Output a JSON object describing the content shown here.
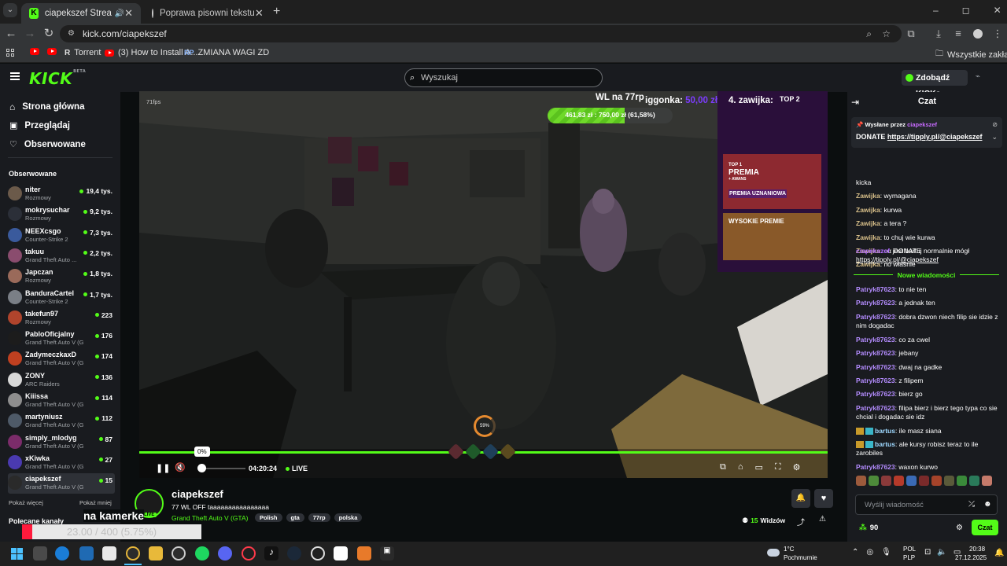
{
  "browser": {
    "tabs": [
      {
        "title": "ciapekszef Stream - Watch",
        "active": true
      },
      {
        "title": "Poprawa pisowni tekstu",
        "active": false
      }
    ],
    "new_tab": "+",
    "window_controls": [
      "–",
      "◻",
      "✕"
    ],
    "url": "kick.com/ciapekszef",
    "bookmarks": [
      "Torrent",
      "(3) How to Install A...",
      "ZMIANA WAGI ZD"
    ],
    "all_bookmarks": "Wszystkie zakładki"
  },
  "kick": {
    "logo": "KICK",
    "logo_badge": "BETA",
    "search_placeholder": "Wyszukaj",
    "get_kicks": "Zdobądź KICKs",
    "nav": [
      "Strona główna",
      "Przeglądaj",
      "Obserwowane"
    ],
    "following_header": "Obserwowane",
    "following": [
      {
        "name": "niter",
        "game": "Rozmowy",
        "viewers": "19,4 tys.",
        "color": "#6b5a4a"
      },
      {
        "name": "mokrysuchar",
        "game": "Rozmowy",
        "viewers": "9,2 tys.",
        "color": "#2b2f38"
      },
      {
        "name": "NEEXcsgo",
        "game": "Counter-Strike 2",
        "viewers": "7,3 tys.",
        "color": "#3a5a9c"
      },
      {
        "name": "takuu",
        "game": "Grand Theft Auto ...",
        "viewers": "2,2 tys.",
        "color": "#8a4c6e"
      },
      {
        "name": "Japczan",
        "game": "Rozmowy",
        "viewers": "1,8 tys.",
        "color": "#9a6a5a"
      },
      {
        "name": "BanduraCartel",
        "game": "Counter-Strike 2",
        "viewers": "1,7 tys.",
        "color": "#7a7f86"
      },
      {
        "name": "takefun97",
        "game": "Rozmowy",
        "viewers": "223",
        "color": "#b0442c"
      },
      {
        "name": "PabloOficjalny",
        "game": "Grand Theft Auto V (G...",
        "viewers": "176",
        "color": "#1c1c1c"
      },
      {
        "name": "ZadymeczkaxD",
        "game": "Grand Theft Auto V (G...",
        "viewers": "174",
        "color": "#c04020"
      },
      {
        "name": "ZONY",
        "game": "ARC Raiders",
        "viewers": "136",
        "color": "#d8d8d8"
      },
      {
        "name": "Kiiissa",
        "game": "Grand Theft Auto V (G...",
        "viewers": "114",
        "color": "#8e8e8e"
      },
      {
        "name": "martyniusz",
        "game": "Grand Theft Auto V (GT...",
        "viewers": "112",
        "color": "#4e5a68"
      },
      {
        "name": "simply_mlodyg",
        "game": "Grand Theft Auto V (GTA)",
        "viewers": "87",
        "color": "#7b2c6a"
      },
      {
        "name": "xKiwka",
        "game": "Grand Theft Auto V (GTA)",
        "viewers": "27",
        "color": "#4a3ab0"
      },
      {
        "name": "ciapekszef",
        "game": "Grand Theft Auto V (GTA)",
        "viewers": "15",
        "color": "#2a2a2a"
      }
    ],
    "show_more": "Pokaż więcej",
    "show_less": "Pokaż mniej",
    "recommended": "Polecane kanały",
    "overlay_kamerka": "na kamerke",
    "overlay_goal": "23.00 / 400 (5.75%)",
    "overlay_goal_progress": 0.0575
  },
  "player": {
    "fps": "71fps",
    "wl_text": "WL na 77rp",
    "goal_label": "iggonka:",
    "goal_amount": "50,00 zł",
    "zawijka": "4. zawijka:",
    "progress_text": "461,83 zł : 750,00 zł (61,58%)",
    "progress_fraction": 0.6158,
    "loading_pct": "59%",
    "volume_tooltip": "0%",
    "time": "04:20:24",
    "live": "LIVE",
    "casino_top1": "TOP 1",
    "casino_premia": "PREMIA",
    "casino_awans": "+ AWANS",
    "casino_top2": "TOP 2",
    "casino_wysokie": "WYSOKIE PREMIE",
    "casino_uzn": "PREMIA UZNANIOWA"
  },
  "streamer": {
    "name": "ciapekszef",
    "title": "77 WL OFF taaaaaaaaaaaaaaaa",
    "game": "Grand Theft Auto V (GTA)",
    "tags": [
      "Polish",
      "gta",
      "77rp",
      "polska"
    ],
    "live_badge": "LIVE",
    "viewers_count": "15",
    "viewers_label": "Widzów"
  },
  "chat": {
    "title": "Czat",
    "pinned_by_label": "Wysłane przez",
    "pinned_by": "ciapekszef",
    "pinned_text": "DONATE",
    "pinned_link": "https://tipply.pl/@ciapekszef",
    "messages_old": [
      {
        "user": "",
        "text": "kicka",
        "color": "#ffffff"
      },
      {
        "user": "Zawijka",
        "text": ": wymagana",
        "color": "#d9c08a"
      },
      {
        "user": "Zawijka",
        "text": ": kurwa",
        "color": "#d9c08a"
      },
      {
        "user": "Zawijka",
        "text": ": a tera ?",
        "color": "#d9c08a"
      },
      {
        "user": "Zawijka",
        "text": ": to chuj wie kurwa",
        "color": "#d9c08a"
      },
      {
        "user": "Zawijka",
        "text": ": co jest bartuj normalnie mógł",
        "color": "#d9c08a"
      },
      {
        "user": "Zawijka",
        "text": ": no właśnie",
        "color": "#d9c08a"
      }
    ],
    "donate_user": "ciapekszef",
    "donate_text": ": DONATE",
    "donate_link": "https://tipply.pl/@ciapekszef",
    "new_messages": "Nowe wiadomości",
    "messages_new": [
      {
        "user": "Patryk87623",
        "text": ": to nie ten",
        "color": "#b48cff"
      },
      {
        "user": "Patryk87623",
        "text": ": a jednak ten",
        "color": "#b48cff"
      },
      {
        "user": "Patryk87623",
        "text": ": dobra dzwon niech filip sie idzie z nim dogadac",
        "color": "#b48cff"
      },
      {
        "user": "Patryk87623",
        "text": ": co za cwel",
        "color": "#b48cff"
      },
      {
        "user": "Patryk87623",
        "text": ": jebany",
        "color": "#b48cff"
      },
      {
        "user": "Patryk87623",
        "text": ": dwaj na gadke",
        "color": "#b48cff"
      },
      {
        "user": "Patryk87623",
        "text": ": z filipem",
        "color": "#b48cff"
      },
      {
        "user": "Patryk87623",
        "text": ": bierz go",
        "color": "#b48cff"
      },
      {
        "user": "Patryk87623",
        "text": ": filipa bierz i bierz tego typa co sie chcial i dogadac sie idz",
        "color": "#b48cff"
      },
      {
        "user": "bartus",
        "text": ": ile masz siana",
        "color": "#9fd9ff"
      },
      {
        "user": "bartus",
        "text": ": ale kursy robisz teraz to ile zarobiles",
        "color": "#9fd9ff"
      },
      {
        "user": "Patryk87623",
        "text": ": waxon kurwo",
        "color": "#b48cff"
      }
    ],
    "input_placeholder": "Wyślij wiadomość",
    "points": "90",
    "send_label": "Czat"
  },
  "taskbar": {
    "weather_temp": "1°C",
    "weather_desc": "Pochmurnie",
    "lang1": "POL",
    "lang2": "PLP",
    "time": "20:38",
    "date": "27.12.2025"
  }
}
